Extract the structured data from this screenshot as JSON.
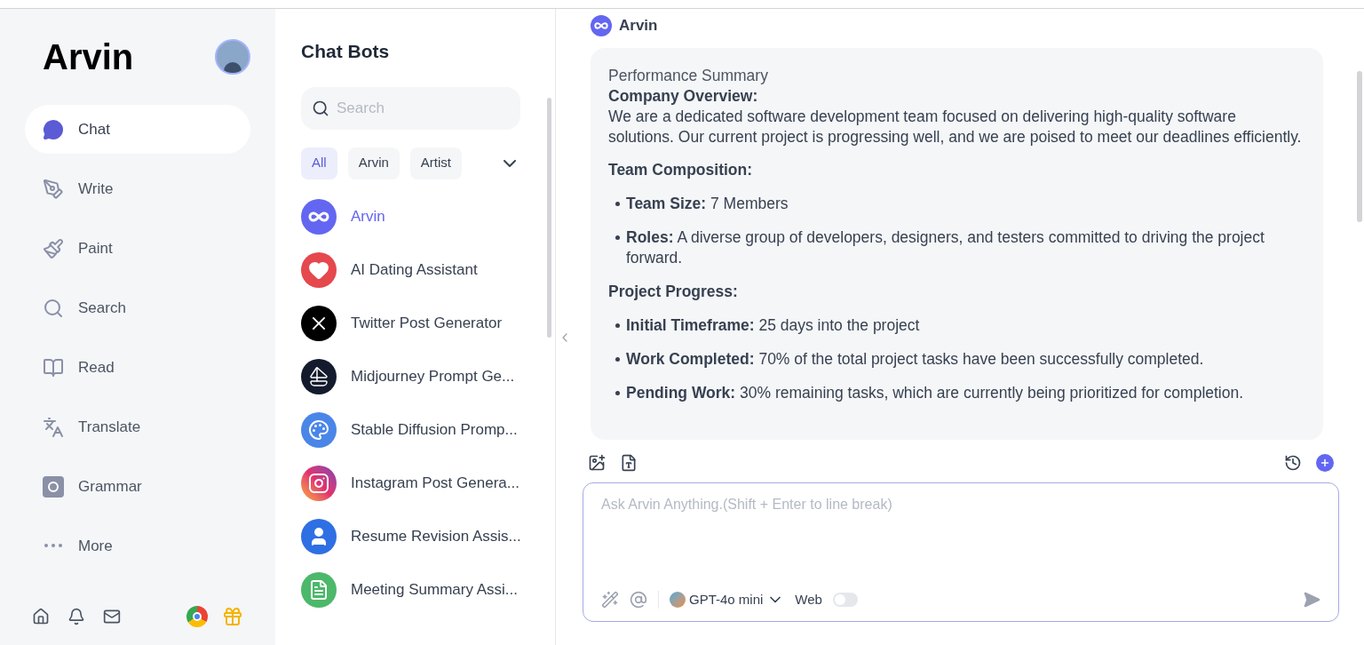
{
  "sidebar": {
    "brand": "Arvin",
    "nav": [
      {
        "label": "Chat",
        "selected": true,
        "kind": "chat"
      },
      {
        "label": "Write",
        "selected": false,
        "kind": "write"
      },
      {
        "label": "Paint",
        "selected": false,
        "kind": "paint"
      },
      {
        "label": "Search",
        "selected": false,
        "kind": "search"
      },
      {
        "label": "Read",
        "selected": false,
        "kind": "read"
      },
      {
        "label": "Translate",
        "selected": false,
        "kind": "translate"
      },
      {
        "label": "Grammar",
        "selected": false,
        "kind": "grammar"
      },
      {
        "label": "More",
        "selected": false,
        "kind": "more"
      }
    ]
  },
  "bots": {
    "title": "Chat Bots",
    "search": {
      "placeholder": "Search"
    },
    "filters": [
      {
        "label": "All",
        "selected": true
      },
      {
        "label": "Arvin",
        "selected": false
      },
      {
        "label": "Artist",
        "selected": false
      }
    ],
    "items": [
      {
        "name": "Arvin",
        "selected": true,
        "kind": "infinity"
      },
      {
        "name": "AI Dating Assistant",
        "selected": false,
        "kind": "heart"
      },
      {
        "name": "Twitter Post Generator",
        "selected": false,
        "kind": "x"
      },
      {
        "name": "Midjourney Prompt Ge...",
        "selected": false,
        "kind": "boat"
      },
      {
        "name": "Stable Diffusion Promp...",
        "selected": false,
        "kind": "palette"
      },
      {
        "name": "Instagram Post Genera...",
        "selected": false,
        "kind": "instagram"
      },
      {
        "name": "Resume Revision Assis...",
        "selected": false,
        "kind": "user"
      },
      {
        "name": "Meeting Summary Assi...",
        "selected": false,
        "kind": "notes"
      }
    ]
  },
  "chat": {
    "sender": "Arvin",
    "message": [
      {
        "kind": "line",
        "text": "Performance Summary"
      },
      {
        "kind": "line_bold",
        "text": "Company Overview:"
      },
      {
        "kind": "paragraph",
        "text": "We are a dedicated software development team focused on delivering high-quality software solutions. Our current project is progressing well, and we are poised to meet our deadlines efficiently."
      },
      {
        "kind": "heading",
        "text": "Team Composition:"
      },
      {
        "kind": "bullet",
        "text": "**Team Size:** 7 Members"
      },
      {
        "kind": "bullet",
        "text": "**Roles:** A diverse group of developers, designers, and testers committed to driving the project forward."
      },
      {
        "kind": "heading",
        "text": "Project Progress:"
      },
      {
        "kind": "bullet",
        "text": "**Initial Timeframe:** 25 days into the project"
      },
      {
        "kind": "bullet",
        "text": "**Work Completed:** 70% of the total project tasks have been successfully completed."
      },
      {
        "kind": "bullet",
        "text": "**Pending Work:** 30% remaining tasks, which are currently being prioritized for completion."
      }
    ],
    "composer": {
      "placeholder": "Ask Arvin Anything.(Shift + Enter to line break)",
      "model": "GPT-4o mini",
      "web_label": "Web",
      "web_on": false
    }
  }
}
